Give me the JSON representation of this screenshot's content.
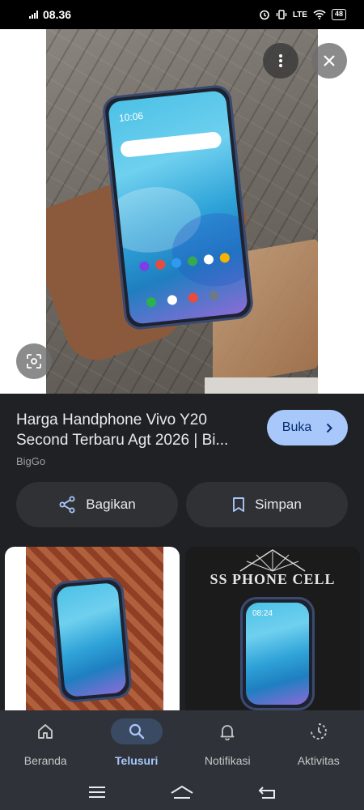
{
  "status_bar": {
    "time": "08.36",
    "network": "LTE",
    "battery": "48"
  },
  "result": {
    "title": "Harga Handphone Vivo Y20 Second Terbaru Agt 2026 | Bi...",
    "source": "BigGo",
    "open_label": "Buka"
  },
  "actions": {
    "share_label": "Bagikan",
    "save_label": "Simpan"
  },
  "photo": {
    "clock": "10:06"
  },
  "related": {
    "right_brand": "SS PHONE CELL",
    "right_clock": "08:24"
  },
  "bottom_nav": [
    {
      "label": "Beranda",
      "icon": "home-icon"
    },
    {
      "label": "Telusuri",
      "icon": "search-icon",
      "active": true
    },
    {
      "label": "Notifikasi",
      "icon": "bell-icon"
    },
    {
      "label": "Aktivitas",
      "icon": "activity-icon"
    }
  ],
  "colors": {
    "accent": "#a8c7fa",
    "background": "#202124",
    "chip": "#303134"
  }
}
